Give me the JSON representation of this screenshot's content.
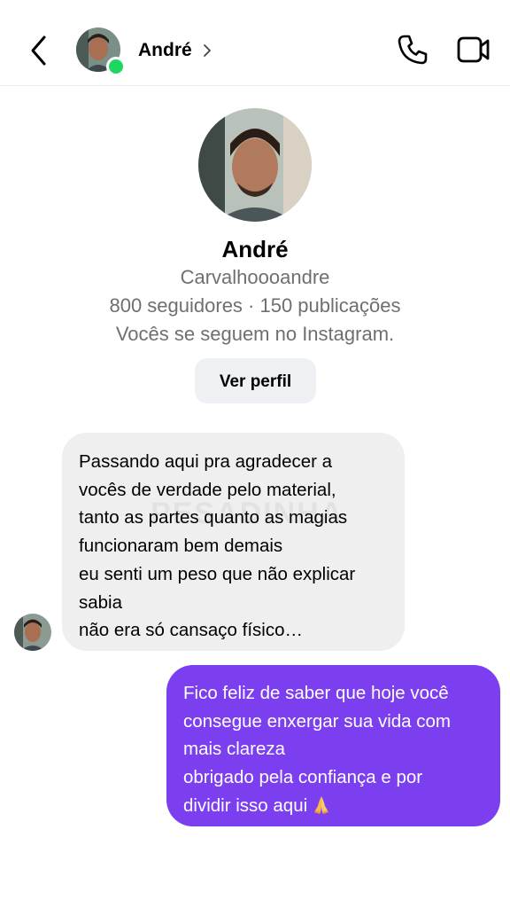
{
  "header": {
    "contact_name": "André",
    "back_icon": "chevron-left-icon",
    "call_icon": "phone-icon",
    "video_icon": "video-camera-icon",
    "status_color": "#1ed760"
  },
  "profile": {
    "name": "André",
    "username": "Carvalhoooandre",
    "stats": "800 seguidores · 150 publicações",
    "mutual": "Vocês se seguem no Instagram.",
    "view_profile_label": "Ver perfil"
  },
  "messages": {
    "incoming": {
      "lines": [
        "Passando aqui pra agradecer a",
        "vocês de verdade pelo material,",
        "tanto as partes quanto as magias",
        "funcionaram bem demais",
        "eu senti um peso que não explicar",
        "sabia",
        "não era só cansaço físico…"
      ],
      "watermark": "PESADINHA"
    },
    "outgoing": {
      "lines": [
        "Fico feliz de saber que hoje você",
        "consegue enxergar sua vida com",
        "mais clareza",
        "obrigado pela confiança e por",
        "dividir isso aqui"
      ],
      "emoji": "praying-hands-icon",
      "bubble_color": "#7c3ff0"
    }
  }
}
